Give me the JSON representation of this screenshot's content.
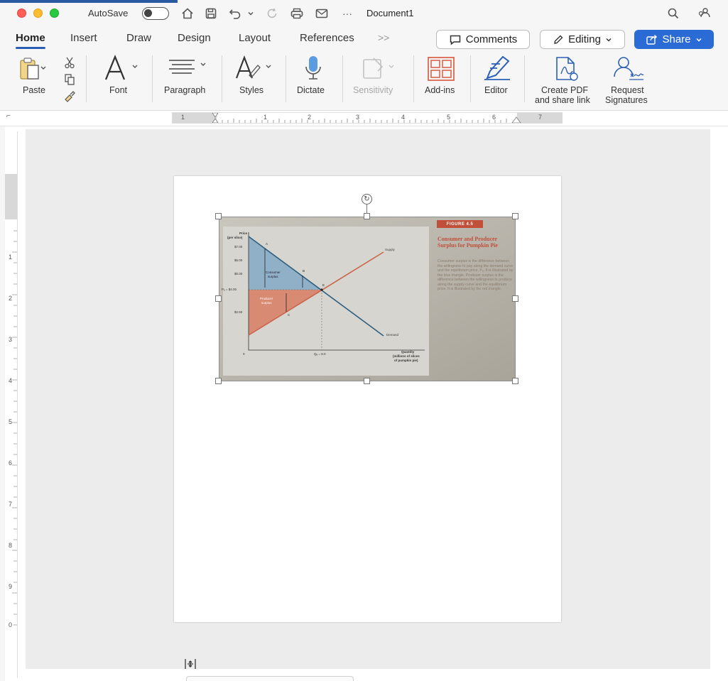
{
  "titlebar": {
    "autosave_label": "AutoSave",
    "document_title": "Document1",
    "more": "···"
  },
  "tabs": [
    {
      "label": "Home",
      "active": true
    },
    {
      "label": "Insert"
    },
    {
      "label": "Draw"
    },
    {
      "label": "Design"
    },
    {
      "label": "Layout"
    },
    {
      "label": "References"
    }
  ],
  "tabs_more": ">>",
  "actions": {
    "comments": "Comments",
    "editing": "Editing",
    "share": "Share"
  },
  "ribbon": {
    "paste": "Paste",
    "font": "Font",
    "paragraph": "Paragraph",
    "styles": "Styles",
    "dictate": "Dictate",
    "sensitivity": "Sensitivity",
    "addins": "Add-ins",
    "editor": "Editor",
    "create_pdf_1": "Create PDF",
    "create_pdf_2": "and share link",
    "request_sig_1": "Request",
    "request_sig_2": "Signatures"
  },
  "ruler": {
    "h_numbers": [
      "1",
      "1",
      "2",
      "3",
      "4",
      "5",
      "6",
      "7"
    ],
    "v_numbers": [
      "1",
      "2",
      "3",
      "4",
      "5",
      "6",
      "7",
      "8",
      "9",
      "0"
    ]
  },
  "figure": {
    "badge": "FIGURE 4.5",
    "title": "Consumer and Producer Surplus for Pumpkin Pie",
    "caption": "Consumer surplus is the difference between the willingness to pay along the demand curve and the equilibrium price, Pₑ. It is illustrated by the blue triangle. Producer surplus is the difference between the willingness to produce along the supply curve and the equilibrium price. It is illustrated by the red triangle.",
    "chart": {
      "y_title_1": "Price",
      "y_title_2": "(per slice)",
      "y_ticks": [
        "$7.00",
        "$6.00",
        "$5.00",
        "Pₑ = $4.00",
        "$2.50"
      ],
      "x_title_1": "Quantity",
      "x_title_2": "(millions of slices",
      "x_title_3": "of pumpkin pie)",
      "x_tick_eq": "Qₑ = 8.0",
      "origin": "0",
      "supply_label": "Supply",
      "demand_label": "Demand",
      "consumer_surplus_1": "Consumer",
      "consumer_surplus_2": "surplus",
      "producer_surplus_1": "Producer",
      "producer_surplus_2": "surplus",
      "point_a": "A",
      "point_b": "B",
      "point_c": "C",
      "point_e": "E",
      "colors": {
        "supply": "#c9664b",
        "demand": "#2f5f7f",
        "consumer": "#8fb0c6",
        "producer": "#d98a72"
      }
    }
  }
}
